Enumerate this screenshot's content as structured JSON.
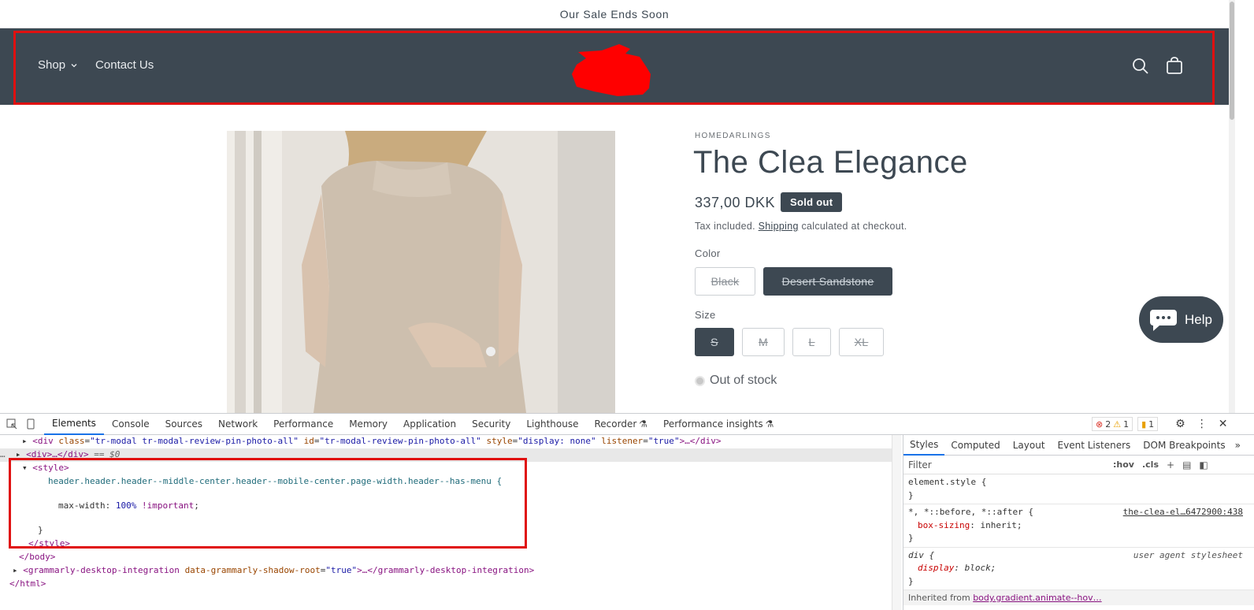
{
  "announcement": "Our Sale Ends Soon",
  "header": {
    "nav": [
      {
        "label": "Shop",
        "has_dropdown": true
      },
      {
        "label": "Contact Us",
        "has_dropdown": false
      }
    ],
    "icons": [
      "search-icon",
      "cart-icon"
    ],
    "colors": {
      "background": "#3d4852",
      "outline": "#e01010"
    }
  },
  "product": {
    "vendor": "HOMEDARLINGS",
    "title": "The Clea Elegance",
    "price": "337,00 DKK",
    "badge": "Sold out",
    "tax_prefix": "Tax included.",
    "tax_link": "Shipping",
    "tax_suffix": "calculated at checkout.",
    "color_label": "Color",
    "colors": [
      "Black",
      "Desert Sandstone"
    ],
    "selected_color": "Desert Sandstone",
    "size_label": "Size",
    "sizes": [
      "S",
      "M",
      "L",
      "XL"
    ],
    "selected_size": "S",
    "stock": "Out of stock"
  },
  "help_button": "Help",
  "devtools": {
    "tabs": [
      "Elements",
      "Console",
      "Sources",
      "Network",
      "Performance",
      "Memory",
      "Application",
      "Security",
      "Lighthouse",
      "Recorder",
      "Performance insights"
    ],
    "active_tab": "Elements",
    "errors": "2",
    "warnings": "1",
    "issues": "1",
    "dom": {
      "line1_tag": "div",
      "line1_class": "tr-modal tr-modal-review-pin-photo-all",
      "line1_id": "tr-modal-review-pin-photo-all",
      "line1_style": "display: none",
      "line1_listener": "true",
      "line2": "<div>…</div>",
      "line2_suffix": "== $0",
      "style_open": "<style>",
      "selector": "header.header.header--middle-center.header--mobile-center.page-width.header--has-menu {",
      "decl_prop": "max-width",
      "decl_value": "100%",
      "decl_important": "!important",
      "close_brace": "}",
      "style_close": "</style>",
      "body_close": "</body>",
      "grammarly_tag": "grammarly-desktop-integration",
      "grammarly_attr": "data-grammarly-shadow-root",
      "grammarly_val": "true",
      "html_close": "</html>"
    },
    "styles_tabs": [
      "Styles",
      "Computed",
      "Layout",
      "Event Listeners",
      "DOM Breakpoints"
    ],
    "filter_placeholder": "Filter",
    "filter_buttons": [
      ":hov",
      ".cls"
    ],
    "rules": [
      {
        "selector": "element.style {",
        "props": [],
        "source": ""
      },
      {
        "selector": "*, *::before, *::after {",
        "props": [
          {
            "name": "box-sizing",
            "value": "inherit"
          }
        ],
        "source": "the-clea-el…6472900:438"
      },
      {
        "selector": "div {",
        "props": [
          {
            "name": "display",
            "value": "block"
          }
        ],
        "source": "user agent stylesheet"
      }
    ],
    "inherited_label": "Inherited from",
    "inherited_from": "body.gradient.animate--hov…"
  }
}
